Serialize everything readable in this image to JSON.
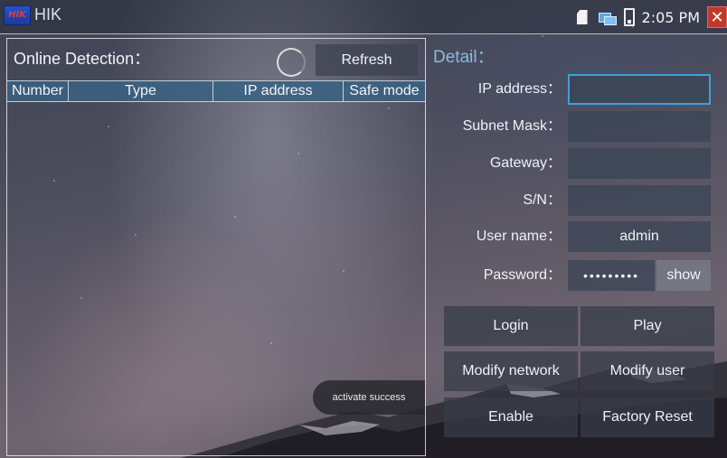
{
  "statusbar": {
    "app_title": "HIK",
    "logo_text": "HIK",
    "time": "2:05 PM",
    "icons": [
      "app-logo-icon",
      "sd-card-icon",
      "network-icon",
      "battery-icon",
      "close-icon"
    ]
  },
  "online": {
    "title": "Online Detection：",
    "refresh_label": "Refresh",
    "columns": [
      "Number",
      "Type",
      "IP address",
      "Safe mode"
    ],
    "rows": [],
    "toast": "activate success"
  },
  "detail": {
    "title": "Detail：",
    "fields": [
      {
        "label": "IP address：",
        "value": ""
      },
      {
        "label": "Subnet Mask：",
        "value": ""
      },
      {
        "label": "Gateway：",
        "value": ""
      },
      {
        "label": "S/N：",
        "value": ""
      },
      {
        "label": "User name：",
        "value": "admin"
      },
      {
        "label": "Password：",
        "value": "•••••••••"
      }
    ],
    "show_label": "show",
    "buttons": {
      "login": "Login",
      "play": "Play",
      "modify_network": "Modify network",
      "modify_user": "Modify user",
      "enable": "Enable",
      "factory_reset": "Factory Reset"
    }
  },
  "colors": {
    "accent": "#3fa0d8",
    "header_bg": "#3a6282",
    "close": "#c0392b"
  }
}
